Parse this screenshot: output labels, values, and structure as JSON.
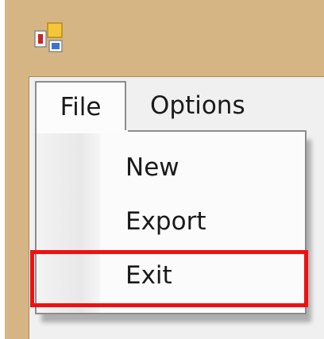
{
  "menubar": {
    "items": [
      {
        "label": "File"
      },
      {
        "label": "Options"
      }
    ]
  },
  "file_menu": {
    "items": [
      {
        "label": "New"
      },
      {
        "label": "Export"
      },
      {
        "label": "Exit"
      }
    ]
  },
  "app_icon": "app-window-icon",
  "colors": {
    "window_border": "#d6b584",
    "highlight": "#ee1111",
    "menu_background": "#fbfbfb"
  }
}
